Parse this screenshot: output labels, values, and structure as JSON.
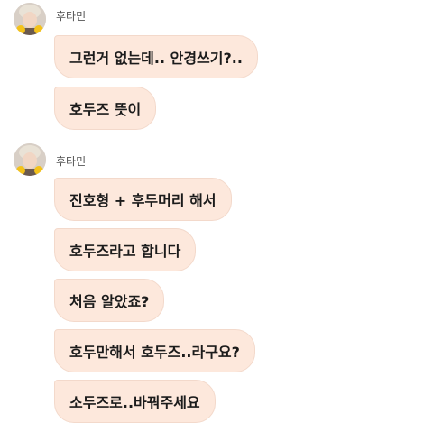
{
  "colors": {
    "bubble": "#fde8dc",
    "bubble_border": "#f3d9cb",
    "sender_text": "#555555"
  },
  "groups": [
    {
      "sender": "후타민",
      "avatar": "profile-avatar",
      "messages": [
        "그런거 없는데.. 안경쓰기?..",
        "호두즈 뜻이"
      ]
    },
    {
      "sender": "후타민",
      "avatar": "profile-avatar",
      "messages": [
        "진호형 + 후두머리 해서",
        "호두즈라고 합니다",
        "처음 알았죠?",
        "호두만해서 호두즈..라구요?",
        "소두즈로..바꿔주세요"
      ]
    }
  ]
}
